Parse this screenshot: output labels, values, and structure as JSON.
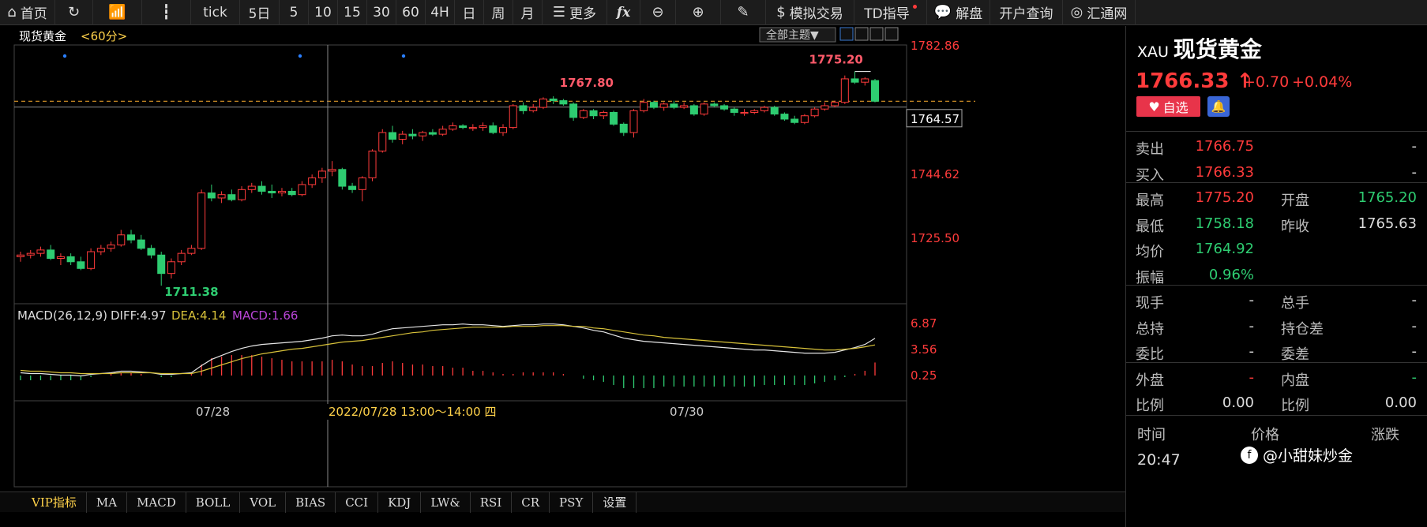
{
  "toolbar": {
    "items": [
      {
        "label": "首页",
        "icon": "home-icon"
      },
      {
        "label": "",
        "icon": "refresh-icon"
      },
      {
        "label": "",
        "icon": "bar-chart-icon"
      },
      {
        "label": "",
        "icon": "candlestick-icon"
      },
      {
        "label": "tick"
      },
      {
        "label": "5日"
      },
      {
        "label": "5"
      },
      {
        "label": "10"
      },
      {
        "label": "15"
      },
      {
        "label": "30"
      },
      {
        "label": "60"
      },
      {
        "label": "4H"
      },
      {
        "label": "日"
      },
      {
        "label": "周"
      },
      {
        "label": "月"
      },
      {
        "label": "更多",
        "icon": "list-icon"
      },
      {
        "label": "fx",
        "icon": "formula-icon"
      },
      {
        "label": "",
        "icon": "zoom-out-icon"
      },
      {
        "label": "",
        "icon": "zoom-in-icon"
      },
      {
        "label": "",
        "icon": "pen-icon"
      },
      {
        "label": "模拟交易",
        "icon": "dollar-icon"
      },
      {
        "label": "TD指导"
      },
      {
        "label": "解盘",
        "icon": "chat-icon"
      },
      {
        "label": "开户查询"
      },
      {
        "label": "汇通网",
        "icon": "logo-icon"
      }
    ]
  },
  "chart": {
    "symbol_name": "现货黄金",
    "period": "<60分>",
    "theme_button": "全部主题▼",
    "price_axis": [
      "1782.86",
      "1744.62",
      "1725.50"
    ],
    "crosshair_price": "1764.57",
    "dashed_level_label": "1766.33",
    "annotations": {
      "high_label": "1775.20",
      "mid_high_label": "1767.80",
      "low_label": "1711.38"
    },
    "x_labels": [
      "07/28",
      "07/30"
    ],
    "crosshair_time": "2022/07/28 13:00～14:00 四",
    "macd": {
      "title": "MACD(26,12,9)",
      "diff": "DIFF:4.97",
      "dea": "DEA:4.14",
      "macd": "MACD:1.66",
      "axis": [
        "6.87",
        "3.56",
        "0.25"
      ]
    },
    "colors": {
      "up": "#ff3b3b",
      "down": "#2ecc71",
      "diff_line": "#e6e6e6",
      "dea_line": "#d8c23a",
      "macd_label": "#b845d6",
      "axis_text": "#ff3b3b"
    }
  },
  "chart_data": {
    "type": "candlestick",
    "title": "现货黄金 <60分>",
    "ylim": [
      1708,
      1786
    ],
    "candles": [
      {
        "o": 1720.0,
        "h": 1721.5,
        "l": 1718.5,
        "c": 1720.5
      },
      {
        "o": 1720.5,
        "h": 1722.0,
        "l": 1719.5,
        "c": 1721.0
      },
      {
        "o": 1721.0,
        "h": 1723.0,
        "l": 1720.0,
        "c": 1722.0
      },
      {
        "o": 1722.0,
        "h": 1723.5,
        "l": 1719.0,
        "c": 1719.5
      },
      {
        "o": 1719.5,
        "h": 1721.0,
        "l": 1717.5,
        "c": 1720.0
      },
      {
        "o": 1720.0,
        "h": 1721.0,
        "l": 1717.5,
        "c": 1718.5
      },
      {
        "o": 1718.5,
        "h": 1720.0,
        "l": 1716.0,
        "c": 1716.5
      },
      {
        "o": 1716.5,
        "h": 1722.5,
        "l": 1716.0,
        "c": 1721.5
      },
      {
        "o": 1721.5,
        "h": 1723.5,
        "l": 1720.5,
        "c": 1722.5
      },
      {
        "o": 1722.5,
        "h": 1724.5,
        "l": 1721.5,
        "c": 1723.5
      },
      {
        "o": 1723.5,
        "h": 1728.0,
        "l": 1723.0,
        "c": 1726.5
      },
      {
        "o": 1726.5,
        "h": 1728.0,
        "l": 1724.0,
        "c": 1725.0
      },
      {
        "o": 1725.0,
        "h": 1726.5,
        "l": 1722.0,
        "c": 1722.5
      },
      {
        "o": 1722.5,
        "h": 1723.5,
        "l": 1719.5,
        "c": 1720.5
      },
      {
        "o": 1720.5,
        "h": 1721.5,
        "l": 1711.38,
        "c": 1715.0
      },
      {
        "o": 1715.0,
        "h": 1719.5,
        "l": 1713.5,
        "c": 1718.5
      },
      {
        "o": 1718.5,
        "h": 1722.0,
        "l": 1717.5,
        "c": 1721.0
      },
      {
        "o": 1721.0,
        "h": 1723.5,
        "l": 1720.5,
        "c": 1722.5
      },
      {
        "o": 1722.5,
        "h": 1740.0,
        "l": 1722.0,
        "c": 1739.0
      },
      {
        "o": 1739.0,
        "h": 1741.5,
        "l": 1736.5,
        "c": 1737.5
      },
      {
        "o": 1737.5,
        "h": 1739.5,
        "l": 1736.0,
        "c": 1738.5
      },
      {
        "o": 1738.5,
        "h": 1740.0,
        "l": 1736.5,
        "c": 1737.0
      },
      {
        "o": 1737.0,
        "h": 1741.0,
        "l": 1736.5,
        "c": 1740.0
      },
      {
        "o": 1740.0,
        "h": 1742.0,
        "l": 1739.0,
        "c": 1741.0
      },
      {
        "o": 1741.0,
        "h": 1742.5,
        "l": 1738.5,
        "c": 1739.5
      },
      {
        "o": 1739.5,
        "h": 1741.5,
        "l": 1737.5,
        "c": 1739.0
      },
      {
        "o": 1739.0,
        "h": 1740.5,
        "l": 1738.0,
        "c": 1739.5
      },
      {
        "o": 1739.5,
        "h": 1740.5,
        "l": 1738.0,
        "c": 1738.5
      },
      {
        "o": 1738.5,
        "h": 1742.5,
        "l": 1738.0,
        "c": 1741.5
      },
      {
        "o": 1741.5,
        "h": 1744.5,
        "l": 1740.5,
        "c": 1743.5
      },
      {
        "o": 1743.5,
        "h": 1746.5,
        "l": 1742.0,
        "c": 1745.5
      },
      {
        "o": 1745.5,
        "h": 1748.5,
        "l": 1744.0,
        "c": 1746.0
      },
      {
        "o": 1746.0,
        "h": 1746.5,
        "l": 1740.0,
        "c": 1741.0
      },
      {
        "o": 1741.0,
        "h": 1742.0,
        "l": 1739.0,
        "c": 1740.0
      },
      {
        "o": 1740.0,
        "h": 1744.0,
        "l": 1736.5,
        "c": 1743.5
      },
      {
        "o": 1743.5,
        "h": 1752.0,
        "l": 1742.5,
        "c": 1751.5
      },
      {
        "o": 1751.5,
        "h": 1758.0,
        "l": 1751.0,
        "c": 1757.0
      },
      {
        "o": 1757.0,
        "h": 1759.0,
        "l": 1754.0,
        "c": 1755.0
      },
      {
        "o": 1755.0,
        "h": 1757.5,
        "l": 1753.5,
        "c": 1756.5
      },
      {
        "o": 1756.5,
        "h": 1758.0,
        "l": 1755.0,
        "c": 1756.0
      },
      {
        "o": 1756.0,
        "h": 1757.5,
        "l": 1754.5,
        "c": 1757.0
      },
      {
        "o": 1757.0,
        "h": 1758.0,
        "l": 1756.0,
        "c": 1756.5
      },
      {
        "o": 1756.5,
        "h": 1759.0,
        "l": 1756.0,
        "c": 1758.0
      },
      {
        "o": 1758.0,
        "h": 1760.0,
        "l": 1757.5,
        "c": 1759.0
      },
      {
        "o": 1759.0,
        "h": 1759.5,
        "l": 1758.0,
        "c": 1758.5
      },
      {
        "o": 1758.5,
        "h": 1759.5,
        "l": 1757.5,
        "c": 1758.5
      },
      {
        "o": 1758.5,
        "h": 1760.0,
        "l": 1757.5,
        "c": 1759.0
      },
      {
        "o": 1759.0,
        "h": 1760.0,
        "l": 1756.5,
        "c": 1757.0
      },
      {
        "o": 1757.0,
        "h": 1759.5,
        "l": 1756.0,
        "c": 1758.5
      },
      {
        "o": 1758.5,
        "h": 1765.5,
        "l": 1758.0,
        "c": 1765.0
      },
      {
        "o": 1765.0,
        "h": 1766.0,
        "l": 1762.5,
        "c": 1763.5
      },
      {
        "o": 1763.5,
        "h": 1765.5,
        "l": 1763.0,
        "c": 1764.5
      },
      {
        "o": 1764.5,
        "h": 1767.5,
        "l": 1764.0,
        "c": 1767.0
      },
      {
        "o": 1767.0,
        "h": 1767.8,
        "l": 1765.5,
        "c": 1766.5
      },
      {
        "o": 1766.5,
        "h": 1767.0,
        "l": 1765.0,
        "c": 1765.5
      },
      {
        "o": 1765.5,
        "h": 1766.0,
        "l": 1760.5,
        "c": 1761.5
      },
      {
        "o": 1761.5,
        "h": 1764.0,
        "l": 1761.0,
        "c": 1763.5
      },
      {
        "o": 1763.5,
        "h": 1764.0,
        "l": 1761.0,
        "c": 1762.0
      },
      {
        "o": 1762.0,
        "h": 1763.5,
        "l": 1761.0,
        "c": 1763.0
      },
      {
        "o": 1763.0,
        "h": 1763.5,
        "l": 1759.0,
        "c": 1759.5
      },
      {
        "o": 1759.5,
        "h": 1760.0,
        "l": 1756.0,
        "c": 1757.0
      },
      {
        "o": 1757.0,
        "h": 1764.0,
        "l": 1755.5,
        "c": 1763.5
      },
      {
        "o": 1763.5,
        "h": 1767.0,
        "l": 1763.0,
        "c": 1766.0
      },
      {
        "o": 1766.0,
        "h": 1766.5,
        "l": 1764.0,
        "c": 1764.5
      },
      {
        "o": 1764.5,
        "h": 1766.0,
        "l": 1763.5,
        "c": 1765.5
      },
      {
        "o": 1765.5,
        "h": 1766.5,
        "l": 1764.0,
        "c": 1764.5
      },
      {
        "o": 1764.5,
        "h": 1766.0,
        "l": 1764.0,
        "c": 1765.0
      },
      {
        "o": 1765.0,
        "h": 1765.5,
        "l": 1762.0,
        "c": 1762.5
      },
      {
        "o": 1762.5,
        "h": 1766.0,
        "l": 1762.0,
        "c": 1765.5
      },
      {
        "o": 1765.5,
        "h": 1766.0,
        "l": 1764.5,
        "c": 1765.0
      },
      {
        "o": 1765.0,
        "h": 1765.5,
        "l": 1763.5,
        "c": 1764.0
      },
      {
        "o": 1764.0,
        "h": 1764.5,
        "l": 1762.0,
        "c": 1763.0
      },
      {
        "o": 1763.0,
        "h": 1764.0,
        "l": 1762.0,
        "c": 1763.0
      },
      {
        "o": 1763.0,
        "h": 1764.0,
        "l": 1762.5,
        "c": 1763.5
      },
      {
        "o": 1763.5,
        "h": 1765.0,
        "l": 1763.0,
        "c": 1764.5
      },
      {
        "o": 1764.5,
        "h": 1765.0,
        "l": 1762.0,
        "c": 1762.5
      },
      {
        "o": 1762.5,
        "h": 1763.0,
        "l": 1760.5,
        "c": 1761.0
      },
      {
        "o": 1761.0,
        "h": 1762.0,
        "l": 1759.5,
        "c": 1760.0
      },
      {
        "o": 1760.0,
        "h": 1762.5,
        "l": 1759.5,
        "c": 1762.0
      },
      {
        "o": 1762.0,
        "h": 1764.5,
        "l": 1761.5,
        "c": 1764.0
      },
      {
        "o": 1764.0,
        "h": 1766.0,
        "l": 1763.5,
        "c": 1765.0
      },
      {
        "o": 1765.0,
        "h": 1766.5,
        "l": 1764.5,
        "c": 1766.0
      },
      {
        "o": 1766.0,
        "h": 1774.0,
        "l": 1765.5,
        "c": 1773.0
      },
      {
        "o": 1773.0,
        "h": 1775.2,
        "l": 1771.5,
        "c": 1772.0
      },
      {
        "o": 1772.0,
        "h": 1773.5,
        "l": 1771.0,
        "c": 1773.0
      },
      {
        "o": 1772.5,
        "h": 1773.0,
        "l": 1766.0,
        "c": 1766.33
      }
    ],
    "macd_ylim": [
      -1.5,
      7.5
    ],
    "macd_axis": [
      6.87,
      3.56,
      0.25
    ],
    "diff": [
      0.6,
      0.5,
      0.5,
      0.4,
      0.3,
      0.3,
      0.2,
      0.4,
      0.5,
      0.6,
      0.8,
      0.8,
      0.7,
      0.6,
      0.4,
      0.4,
      0.5,
      0.6,
      1.5,
      2.3,
      2.8,
      3.3,
      3.7,
      4.0,
      4.2,
      4.3,
      4.4,
      4.5,
      4.6,
      4.8,
      5.0,
      5.3,
      5.4,
      5.3,
      5.3,
      5.5,
      5.9,
      6.2,
      6.3,
      6.4,
      6.5,
      6.6,
      6.7,
      6.7,
      6.8,
      6.7,
      6.7,
      6.6,
      6.5,
      6.6,
      6.7,
      6.7,
      6.8,
      6.8,
      6.7,
      6.5,
      6.3,
      6.0,
      5.8,
      5.4,
      5.0,
      4.8,
      4.6,
      4.5,
      4.4,
      4.3,
      4.2,
      4.1,
      4.0,
      3.9,
      3.8,
      3.7,
      3.6,
      3.5,
      3.5,
      3.4,
      3.3,
      3.2,
      3.1,
      3.1,
      3.1,
      3.2,
      3.5,
      3.8,
      4.2,
      4.97
    ],
    "dea": [
      0.9,
      0.8,
      0.8,
      0.7,
      0.6,
      0.6,
      0.5,
      0.5,
      0.5,
      0.5,
      0.6,
      0.6,
      0.6,
      0.6,
      0.5,
      0.5,
      0.5,
      0.5,
      0.8,
      1.2,
      1.6,
      2.0,
      2.4,
      2.7,
      3.0,
      3.2,
      3.4,
      3.6,
      3.7,
      3.9,
      4.1,
      4.3,
      4.5,
      4.6,
      4.7,
      4.9,
      5.1,
      5.3,
      5.5,
      5.7,
      5.8,
      6.0,
      6.1,
      6.2,
      6.3,
      6.4,
      6.4,
      6.4,
      6.4,
      6.5,
      6.5,
      6.5,
      6.6,
      6.6,
      6.6,
      6.5,
      6.5,
      6.3,
      6.2,
      6.0,
      5.8,
      5.6,
      5.4,
      5.3,
      5.1,
      5.0,
      4.9,
      4.8,
      4.7,
      4.6,
      4.5,
      4.4,
      4.3,
      4.2,
      4.1,
      4.0,
      3.9,
      3.8,
      3.7,
      3.6,
      3.5,
      3.5,
      3.6,
      3.7,
      3.9,
      4.14
    ]
  },
  "right_panel": {
    "code": "XAU",
    "name": "现货黄金",
    "price": "1766.33",
    "arrow": "↑",
    "change": "+0.70",
    "change_pct": "+0.04%",
    "fav_label": "自选",
    "rows": [
      {
        "l1": "卖出",
        "v1": "1766.75",
        "l2": "",
        "v2": "-"
      },
      {
        "l1": "买入",
        "v1": "1766.33",
        "l2": "",
        "v2": "-"
      },
      {
        "l1": "最高",
        "v1": "1775.20",
        "l2": "开盘",
        "v2": "1765.20"
      },
      {
        "l1": "最低",
        "v1": "1758.18",
        "l2": "昨收",
        "v2": "1765.63"
      },
      {
        "l1": "均价",
        "v1": "1764.92",
        "l2": "",
        "v2": ""
      },
      {
        "l1": "振幅",
        "v1": "0.96%",
        "l2": "",
        "v2": ""
      },
      {
        "l1": "现手",
        "v1": "-",
        "l2": "总手",
        "v2": "-"
      },
      {
        "l1": "总持",
        "v1": "-",
        "l2": "持仓差",
        "v2": "-"
      },
      {
        "l1": "委比",
        "v1": "-",
        "l2": "委差",
        "v2": "-"
      },
      {
        "l1": "外盘",
        "v1": "-",
        "l2": "内盘",
        "v2": "-"
      },
      {
        "l1": "比例",
        "v1": "0.00",
        "l2": "比例",
        "v2": "0.00"
      }
    ],
    "trade_headers": [
      "时间",
      "价格",
      "涨跌"
    ],
    "trade_time": "20:47",
    "watermark": "@小甜妹炒金"
  },
  "bottom_tabs": [
    "VIP指标",
    "MA",
    "MACD",
    "BOLL",
    "VOL",
    "BIAS",
    "CCI",
    "KDJ",
    "LW&",
    "RSI",
    "CR",
    "PSY",
    "设置"
  ]
}
